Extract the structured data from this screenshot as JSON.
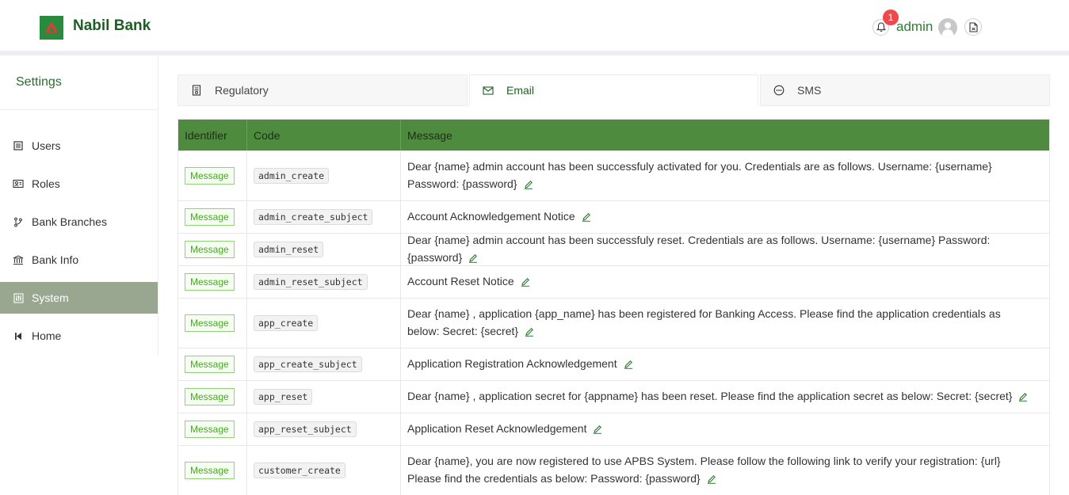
{
  "app": {
    "brand": "Nabil Bank",
    "notification_count": "1",
    "user_name": "admin"
  },
  "sidebar": {
    "title": "Settings",
    "items": [
      {
        "label": "Users",
        "icon": "users-list-icon"
      },
      {
        "label": "Roles",
        "icon": "id-card-icon"
      },
      {
        "label": "Bank Branches",
        "icon": "branch-icon"
      },
      {
        "label": "Bank Info",
        "icon": "bank-icon"
      },
      {
        "label": "System",
        "icon": "sliders-icon",
        "active": true
      },
      {
        "label": "Home",
        "icon": "step-back-icon"
      }
    ]
  },
  "tabs": [
    {
      "label": "Regulatory",
      "icon": "document-icon"
    },
    {
      "label": "Email",
      "icon": "mail-icon",
      "active": true
    },
    {
      "label": "SMS",
      "icon": "chat-icon"
    }
  ],
  "table": {
    "headers": [
      "Identifier",
      "Code",
      "Message"
    ],
    "rows": [
      {
        "identifier": "Message",
        "code": "admin_create",
        "message": "Dear {name} admin account has been successfuly activated for you. Credentials are as follows. Username: {username} Password: {password}"
      },
      {
        "identifier": "Message",
        "code": "admin_create_subject",
        "message": "Account Acknowledgement Notice"
      },
      {
        "identifier": "Message",
        "code": "admin_reset",
        "message": "Dear {name} admin account has been successfuly reset. Credentials are as follows. Username: {username} Password: {password}"
      },
      {
        "identifier": "Message",
        "code": "admin_reset_subject",
        "message": "Account Reset Notice"
      },
      {
        "identifier": "Message",
        "code": "app_create",
        "message": "Dear {name} , application {app_name} has been registered for Banking Access. Please find the application credentials as below: Secret: {secret}"
      },
      {
        "identifier": "Message",
        "code": "app_create_subject",
        "message": "Application Registration Acknowledgement"
      },
      {
        "identifier": "Message",
        "code": "app_reset",
        "message": "Dear {name} , application secret for {appname} has been reset. Please find the application secret as below: Secret: {secret}"
      },
      {
        "identifier": "Message",
        "code": "app_reset_subject",
        "message": "Application Reset Acknowledgement"
      },
      {
        "identifier": "Message",
        "code": "customer_create",
        "message": "Dear {name}, you are now registered to use APBS System. Please follow the following link to verify your registration: {url} Please find the credentials as below: Password: {password}"
      }
    ]
  },
  "colors": {
    "brand_green": "#1d5e22",
    "header_green": "#4e8b3f",
    "active_nav": "#9aa790",
    "badge_red": "#f0484b",
    "tag_green": "#47a823"
  }
}
